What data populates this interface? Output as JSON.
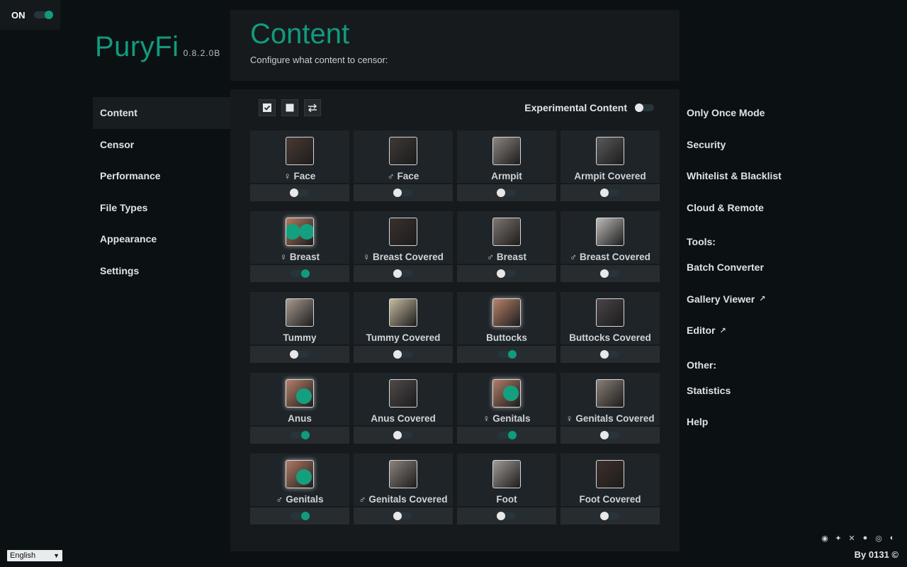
{
  "power": {
    "label": "ON",
    "on": true
  },
  "logo": {
    "name": "PuryFi",
    "version": "0.8.2.0B"
  },
  "left_nav": [
    {
      "label": "Content",
      "active": true
    },
    {
      "label": "Censor"
    },
    {
      "label": "Performance"
    },
    {
      "label": "File Types"
    },
    {
      "label": "Appearance"
    },
    {
      "label": "Settings"
    }
  ],
  "header": {
    "title": "Content",
    "subtitle": "Configure what content to censor:"
  },
  "experimental": {
    "label": "Experimental Content",
    "on": false
  },
  "items": [
    {
      "label": "♀ Face",
      "on": false,
      "icon": "female-face-icon",
      "thumb_color": "#4b3a33"
    },
    {
      "label": "♂ Face",
      "on": false,
      "icon": "male-face-icon",
      "thumb_color": "#3d3936"
    },
    {
      "label": "Armpit",
      "on": false,
      "icon": "armpit-icon",
      "thumb_color": "#8b8580"
    },
    {
      "label": "Armpit Covered",
      "on": false,
      "icon": "armpit-covered-icon",
      "thumb_color": "#5a5a5c"
    },
    {
      "label": "♀ Breast",
      "on": true,
      "icon": "female-breast-icon",
      "thumb_color": "#b07a61"
    },
    {
      "label": "♀ Breast Covered",
      "on": false,
      "icon": "female-breast-covered-icon",
      "thumb_color": "#39312e"
    },
    {
      "label": "♂ Breast",
      "on": false,
      "icon": "male-breast-icon",
      "thumb_color": "#7e756f"
    },
    {
      "label": "♂ Breast Covered",
      "on": false,
      "icon": "male-breast-covered-icon",
      "thumb_color": "#bdbbb9"
    },
    {
      "label": "Tummy",
      "on": false,
      "icon": "tummy-icon",
      "thumb_color": "#a89a8f"
    },
    {
      "label": "Tummy Covered",
      "on": false,
      "icon": "tummy-covered-icon",
      "thumb_color": "#c7bba0"
    },
    {
      "label": "Buttocks",
      "on": true,
      "icon": "buttocks-icon",
      "thumb_color": "#b9826a"
    },
    {
      "label": "Buttocks Covered",
      "on": false,
      "icon": "buttocks-covered-icon",
      "thumb_color": "#4a4448"
    },
    {
      "label": "Anus",
      "on": true,
      "icon": "anus-icon",
      "thumb_color": "#b5806a"
    },
    {
      "label": "Anus Covered",
      "on": false,
      "icon": "anus-covered-icon",
      "thumb_color": "#504a4a"
    },
    {
      "label": "♀ Genitals",
      "on": true,
      "icon": "female-genitals-icon",
      "thumb_color": "#b27c66"
    },
    {
      "label": "♀ Genitals Covered",
      "on": false,
      "icon": "female-genitals-covered-icon",
      "thumb_color": "#8a7e78"
    },
    {
      "label": "♂ Genitals",
      "on": true,
      "icon": "male-genitals-icon",
      "thumb_color": "#b07a65"
    },
    {
      "label": "♂ Genitals Covered",
      "on": false,
      "icon": "male-genitals-covered-icon",
      "thumb_color": "#8b827c"
    },
    {
      "label": "Foot",
      "on": false,
      "icon": "foot-icon",
      "thumb_color": "#9f9a96"
    },
    {
      "label": "Foot Covered",
      "on": false,
      "icon": "foot-covered-icon",
      "thumb_color": "#3e2f2c"
    }
  ],
  "right_nav": {
    "items": [
      "Only Once Mode",
      "Security",
      "Whitelist & Blacklist",
      "Cloud & Remote"
    ],
    "tools_heading": "Tools:",
    "tools": [
      "Batch Converter",
      "Gallery Viewer",
      "Editor"
    ],
    "other_heading": "Other:",
    "other": [
      "Statistics",
      "Help"
    ]
  },
  "language": {
    "selected": "English"
  },
  "credit": "By 0131 ©",
  "colors": {
    "accent": "#129a7e",
    "toggle_on": "#119a7c",
    "background": "#0b1013",
    "panel": "#161a1d"
  }
}
